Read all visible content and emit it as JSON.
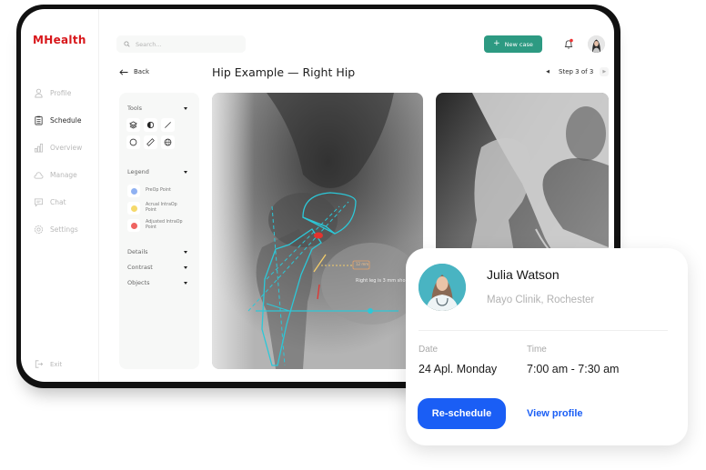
{
  "app": {
    "brand": "MHealth",
    "brand_color": "#d8171b",
    "accent": "#2d9a82"
  },
  "sidebar": {
    "items": [
      {
        "label": "Profile",
        "icon": "user-icon",
        "active": false
      },
      {
        "label": "Schedule",
        "icon": "clipboard-icon",
        "active": true
      },
      {
        "label": "Overview",
        "icon": "bar-chart-icon",
        "active": false
      },
      {
        "label": "Manage",
        "icon": "cloud-icon",
        "active": false
      },
      {
        "label": "Chat",
        "icon": "chat-icon",
        "active": false
      },
      {
        "label": "Settings",
        "icon": "gear-icon",
        "active": false
      }
    ],
    "exit_label": "Exit"
  },
  "header": {
    "search_placeholder": "Search...",
    "new_case_label": "New case",
    "notification_dot": true
  },
  "page": {
    "back_label": "Back",
    "title": "Hip Example — Right Hip",
    "step_label": "Step 3 of 3"
  },
  "tools_panel": {
    "tools_label": "Tools",
    "tools": [
      "layers-icon",
      "contrast-icon",
      "line-icon",
      "circle-icon",
      "ruler-icon",
      "globe-icon"
    ],
    "legend_label": "Legend",
    "legend": [
      {
        "label": "PreOp Point",
        "color": "#8fb1f2"
      },
      {
        "label": "Acrual IntraOp Point",
        "color": "#f5d96b"
      },
      {
        "label": "Adjusted IntraOp Point",
        "color": "#ef6461"
      }
    ],
    "sections": [
      "Details",
      "Contrast",
      "Objects"
    ]
  },
  "xray": {
    "measurement": "12 mm",
    "annotation": "Right leg is 3 mm sho"
  },
  "card": {
    "name": "Julia Watson",
    "org": "Mayo Clinik, Rochester",
    "date_label": "Date",
    "date_value": "24 Apl. Monday",
    "time_label": "Time",
    "time_value": "7:00 am - 7:30 am",
    "reschedule_label": "Re-schedule",
    "view_profile_label": "View profile"
  }
}
